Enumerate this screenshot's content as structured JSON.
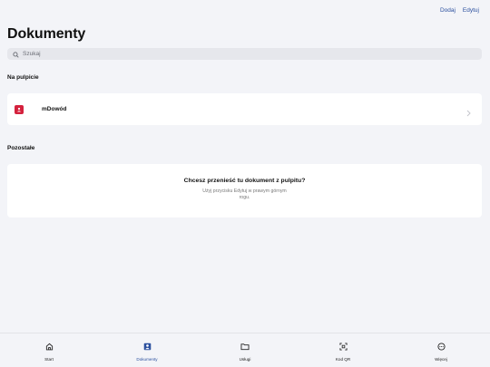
{
  "header": {
    "add_label": "Dodaj",
    "edit_label": "Edytuj",
    "title": "Dokumenty"
  },
  "search": {
    "placeholder": "Szukaj",
    "value": ""
  },
  "sections": {
    "desktop": {
      "title": "Na pulpicie",
      "items": [
        {
          "label": "mDowód",
          "icon": "id-card-icon",
          "icon_color": "#d4213d"
        }
      ]
    },
    "other": {
      "title": "Pozostałe",
      "empty_title": "Chcesz przenieść tu dokument z pulpitu?",
      "empty_hint": "Użyj przycisku Edytuj w prawym górnym rogu."
    }
  },
  "tabbar": {
    "tabs": [
      {
        "label": "Start",
        "icon": "home-icon",
        "active": false
      },
      {
        "label": "Dokumenty",
        "icon": "documents-icon",
        "active": true
      },
      {
        "label": "Usługi",
        "icon": "folder-icon",
        "active": false
      },
      {
        "label": "Kod QR",
        "icon": "qr-scan-icon",
        "active": false
      },
      {
        "label": "Więcej",
        "icon": "more-icon",
        "active": false
      }
    ]
  },
  "colors": {
    "accent": "#2a4f9e",
    "background": "#f3f4f8",
    "card": "#ffffff"
  }
}
